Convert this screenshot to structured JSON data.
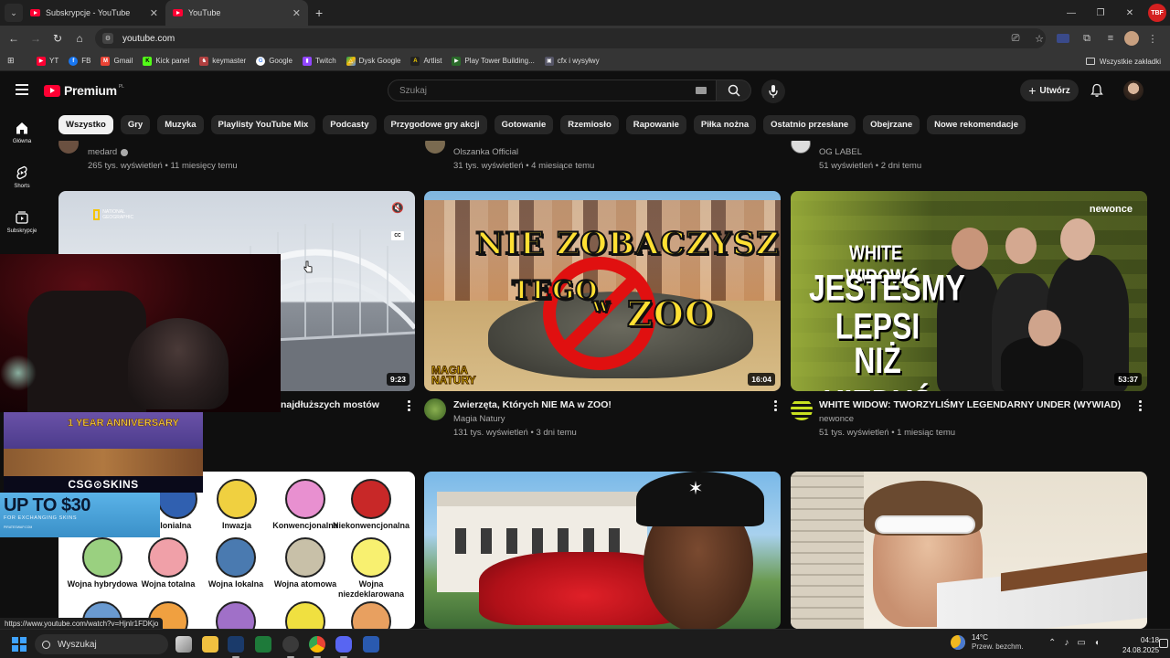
{
  "browser": {
    "tabs": [
      {
        "title": "Subskrypcje - YouTube",
        "active": false
      },
      {
        "title": "YouTube",
        "active": true
      }
    ],
    "url": "youtube.com",
    "bookmarks": [
      "YT",
      "FB",
      "Gmail",
      "Kick panel",
      "keymaster",
      "Google",
      "Twitch",
      "Dysk Google",
      "Artlist",
      "Play Tower Building...",
      "cfx i wysyłwy"
    ],
    "all_bookmarks": "Wszystkie zakładki",
    "profile_badge": "TBF",
    "status_url": "https://www.youtube.com/watch?v=Hjnlr1FDKjo"
  },
  "youtube": {
    "logo_text": "Premium",
    "logo_country": "PL",
    "search_placeholder": "Szukaj",
    "create_label": "Utwórz",
    "sidebar": [
      {
        "label": "Główna",
        "icon": "home-icon"
      },
      {
        "label": "Shorts",
        "icon": "shorts-icon"
      },
      {
        "label": "Subskrypcje",
        "icon": "subscriptions-icon"
      }
    ],
    "chips": [
      "Wszystko",
      "Gry",
      "Muzyka",
      "Playlisty YouTube Mix",
      "Podcasty",
      "Przygodowe gry akcji",
      "Gotowanie",
      "Rzemiosło",
      "Rapowanie",
      "Piłka nożna",
      "Ostatnio przesłane",
      "Obejrzane",
      "Nowe rekomendacje"
    ],
    "partial_row": [
      {
        "channel": "medard",
        "verified": true,
        "stats": "265 tys. wyświetleń • 11 miesięcy temu"
      },
      {
        "channel": "Olszanka Official",
        "verified": false,
        "stats": "31 tys. wyświetleń • 4 miesiące temu"
      },
      {
        "channel": "OG LABEL",
        "verified": false,
        "stats": "51 wyświetleń • 2 dni temu"
      }
    ],
    "row1": [
      {
        "title": "najdłuższych mostów",
        "channel": "",
        "stats": "",
        "duration": "9:23",
        "thumb_brand": "NATIONAL GEOGRAPHIC",
        "mute_icon": "muted-speaker-icon",
        "cc_label": "CC"
      },
      {
        "title": "Zwierzęta, Których NIE MA w ZOO!",
        "channel": "Magia Natury",
        "stats": "131 tys. wyświetleń • 3 dni temu",
        "duration": "16:04",
        "thumb_line1": "NIE ZOBACZYSZ",
        "thumb_line2": "TEGO",
        "thumb_w": "w",
        "thumb_line3": "ZOO",
        "thumb_logo": "MAGIA NATURY"
      },
      {
        "title": "WHITE WIDOW: TWORZYLIŚMY LEGENDARNY UNDER (WYWIAD)",
        "channel": "newonce",
        "stats": "51 tys. wyświetleń • 1 miesiąc temu",
        "duration": "53:37",
        "thumb_brand": "newonce",
        "thumb_l1": "WHITE WIDOW",
        "thumb_l2": "JESTEŚMY",
        "thumb_l3": "LEPSI",
        "thumb_l4": "NIŻ KIEDYŚ"
      }
    ],
    "war_types": [
      {
        "label": "kolonialna"
      },
      {
        "label": "Inwazja"
      },
      {
        "label": "Konwencjonalna"
      },
      {
        "label": "Niekonwencjonalna"
      },
      {
        "label": "Wojna hybrydowa"
      },
      {
        "label": "Wojna totalna"
      },
      {
        "label": "Wojna lokalna"
      },
      {
        "label": "Wojna atomowa"
      },
      {
        "label": "Wojna niezdeklarowana"
      }
    ]
  },
  "overlay": {
    "ad_title": "1 YEAR ANNIVERSARY",
    "ad_brand": "CSG⊙SKINS",
    "ad_headline": "UP TO $30",
    "ad_sub": "FOR EXCHANGING SKINS",
    "ad_site": "PIRATESWAP.COM"
  },
  "taskbar": {
    "search_label": "Wyszukaj",
    "weather_temp": "14°C",
    "weather_desc": "Przew. bezchm.",
    "time": "04:18",
    "date": "24.08.2025"
  }
}
